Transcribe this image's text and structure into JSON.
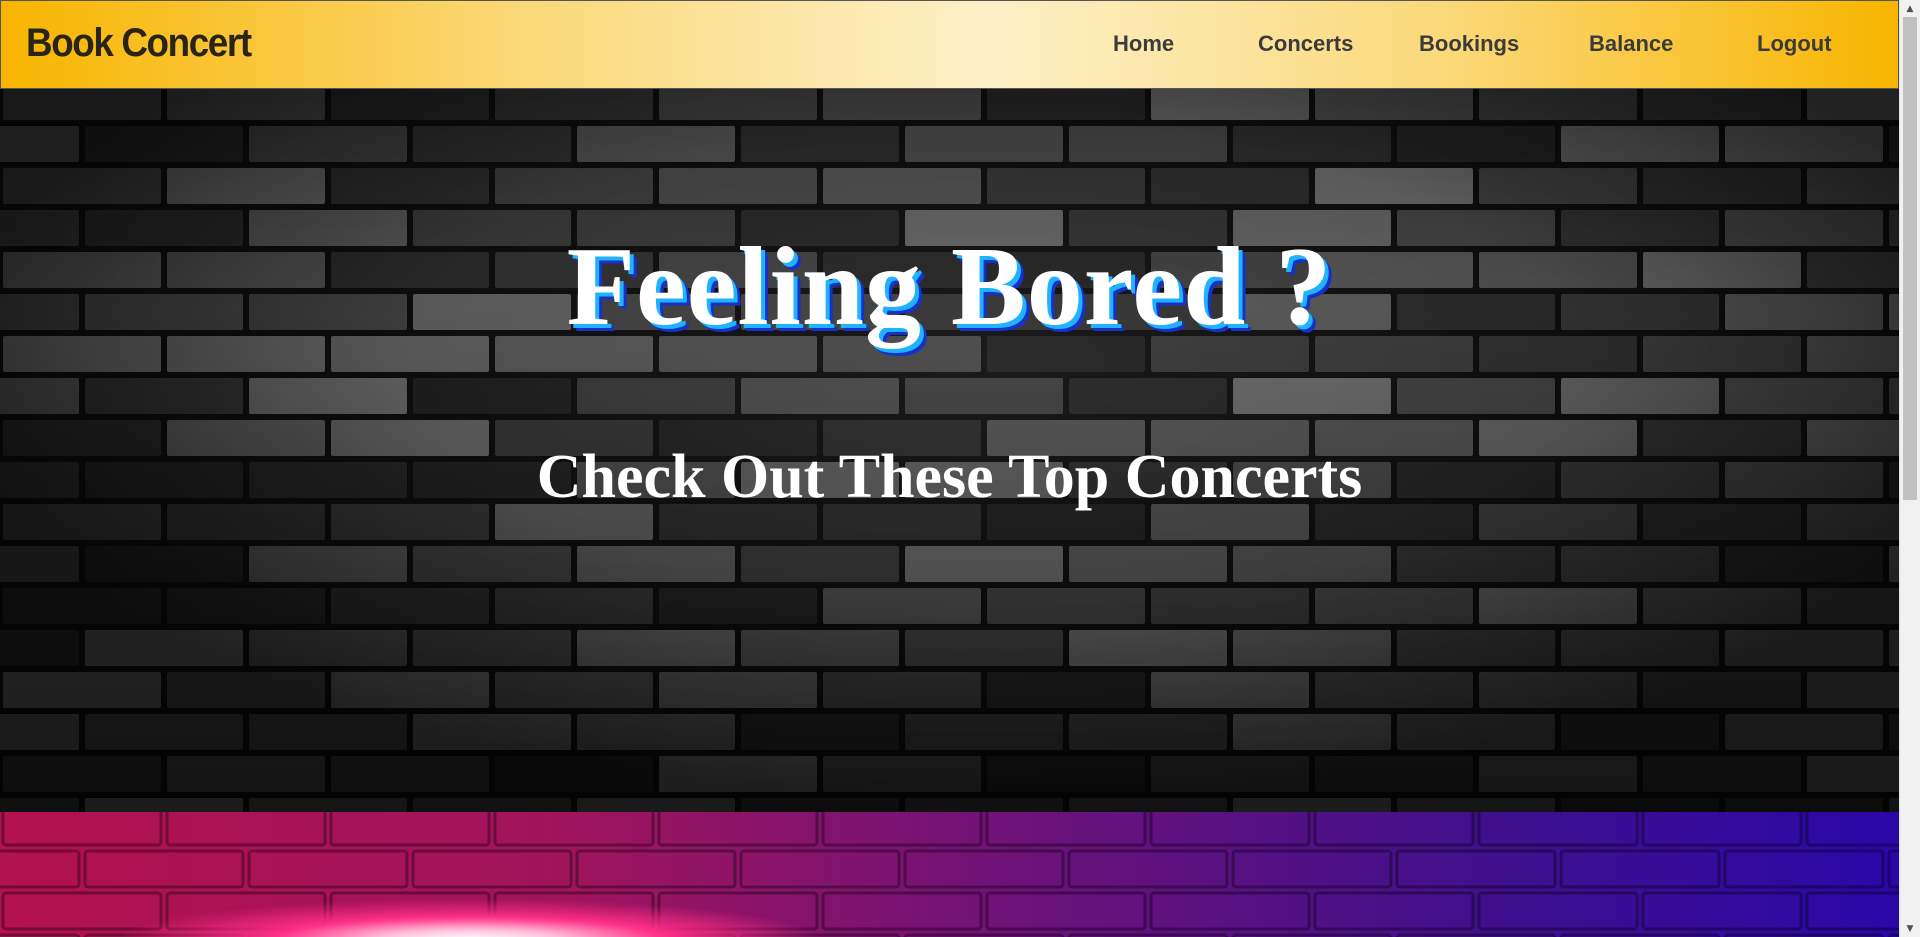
{
  "app": {
    "brand": "Book Concert"
  },
  "nav": {
    "items": [
      {
        "label": "Home"
      },
      {
        "label": "Concerts"
      },
      {
        "label": "Bookings"
      },
      {
        "label": "Balance"
      },
      {
        "label": "Logout"
      }
    ]
  },
  "hero": {
    "title": "Feeling Bored ?",
    "subtitle": "Check Out These Top Concerts"
  },
  "colors": {
    "navbar_gradient_edge": "#f8b500",
    "navbar_gradient_center": "#fdf0c8",
    "title_shadow_cyan": "#1fb3ff",
    "title_shadow_blue": "#1730c8",
    "section_magenta": "#b2124e",
    "section_violet": "#2a08a8"
  },
  "icons": {
    "scroll_up": "scroll-up-arrow-icon",
    "scroll_down": "scroll-down-arrow-icon"
  }
}
